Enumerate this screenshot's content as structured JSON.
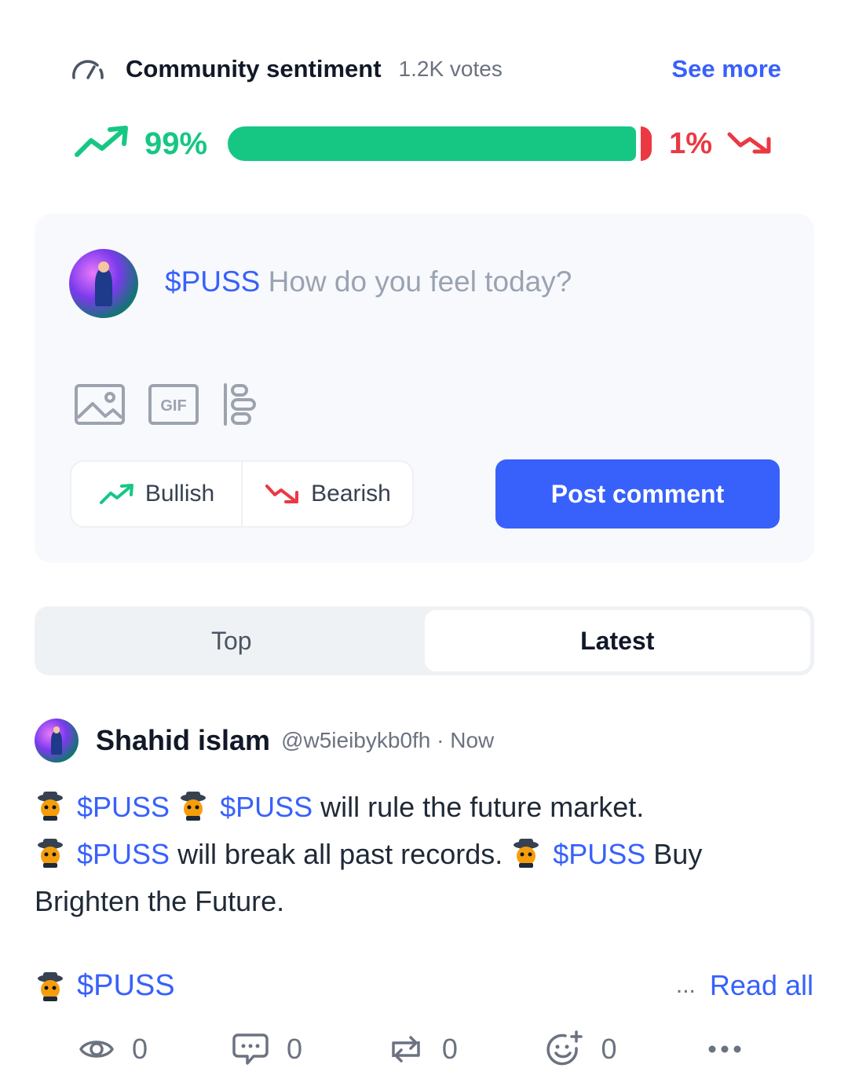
{
  "sentiment": {
    "title": "Community sentiment",
    "votes": "1.2K votes",
    "see_more": "See more",
    "bullish_percent_label": "99%",
    "bearish_percent_label": "1%",
    "bullish_fraction": 0.99,
    "bearish_fraction": 0.01
  },
  "composer": {
    "ticker": "$PUSS",
    "placeholder": "How do you feel today?",
    "tools": [
      "image-icon",
      "gif-icon",
      "poll-icon"
    ],
    "gif_label": "GIF",
    "bullish_label": "Bullish",
    "bearish_label": "Bearish",
    "post_button": "Post comment"
  },
  "tabs": [
    {
      "label": "Top",
      "active": false
    },
    {
      "label": "Latest",
      "active": true
    }
  ],
  "post": {
    "author": "Shahid islam",
    "handle": "@w5ieibykb0fh · Now",
    "line1_ticker_a": "$PUSS",
    "line1_ticker_b": "$PUSS",
    "line1_text": " will rule the future market.",
    "line2_ticker_a": "$PUSS",
    "line2_text": " will break all past records. ",
    "line2_ticker_b": "$PUSS",
    "line2_tail": " Buy",
    "line3_text": "Brighten the Future.",
    "tag": "$PUSS",
    "read_more_dots": "...",
    "read_all": "Read all",
    "views": "0",
    "comments": "0",
    "reposts": "0",
    "reactions": "0"
  },
  "colors": {
    "accent": "#3861fb",
    "bullish": "#16c784",
    "bearish": "#ea3943"
  }
}
